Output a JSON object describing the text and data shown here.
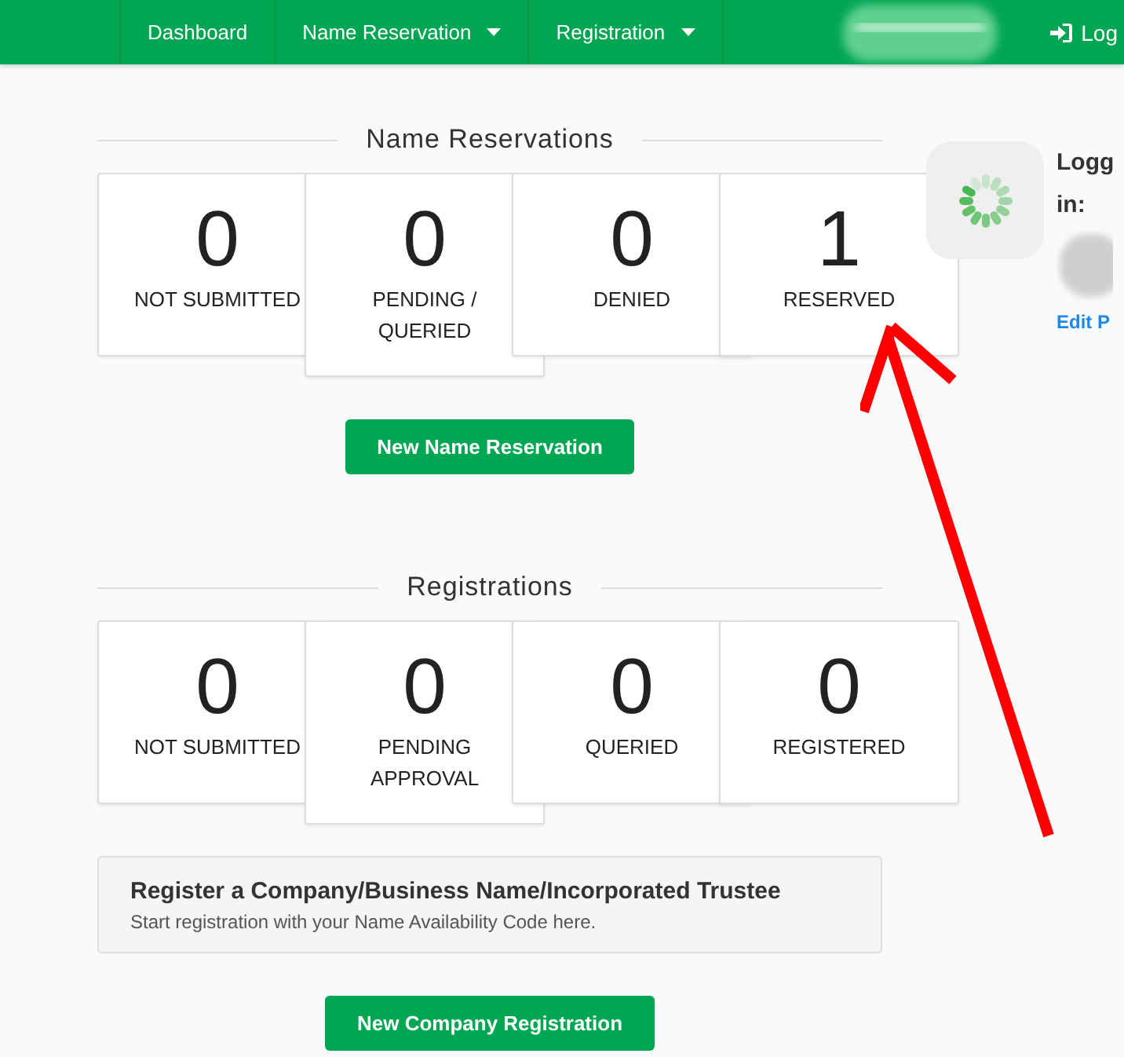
{
  "nav": {
    "items": [
      {
        "label": "Dashboard",
        "dropdown": false
      },
      {
        "label": "Name Reservation",
        "dropdown": true
      },
      {
        "label": "Registration",
        "dropdown": true
      }
    ],
    "login": "Log"
  },
  "sections": [
    {
      "title": "Name Reservations",
      "stats": [
        {
          "value": "0",
          "label": "NOT SUBMITTED"
        },
        {
          "value": "0",
          "label": "PENDING / QUERIED"
        },
        {
          "value": "0",
          "label": "DENIED"
        },
        {
          "value": "1",
          "label": "RESERVED"
        }
      ],
      "button": "New Name Reservation"
    },
    {
      "title": "Registrations",
      "stats": [
        {
          "value": "0",
          "label": "NOT SUBMITTED"
        },
        {
          "value": "0",
          "label": "PENDING APPROVAL"
        },
        {
          "value": "0",
          "label": "QUERIED"
        },
        {
          "value": "0",
          "label": "REGISTERED"
        }
      ],
      "info": {
        "title": "Register a Company/Business Name/Incorporated Trustee",
        "text": "Start registration with your Name Availability Code here."
      },
      "button": "New Company Registration"
    }
  ],
  "user": {
    "logged_in_1": "Logg",
    "logged_in_2": "in:",
    "edit_link": "Edit P"
  }
}
